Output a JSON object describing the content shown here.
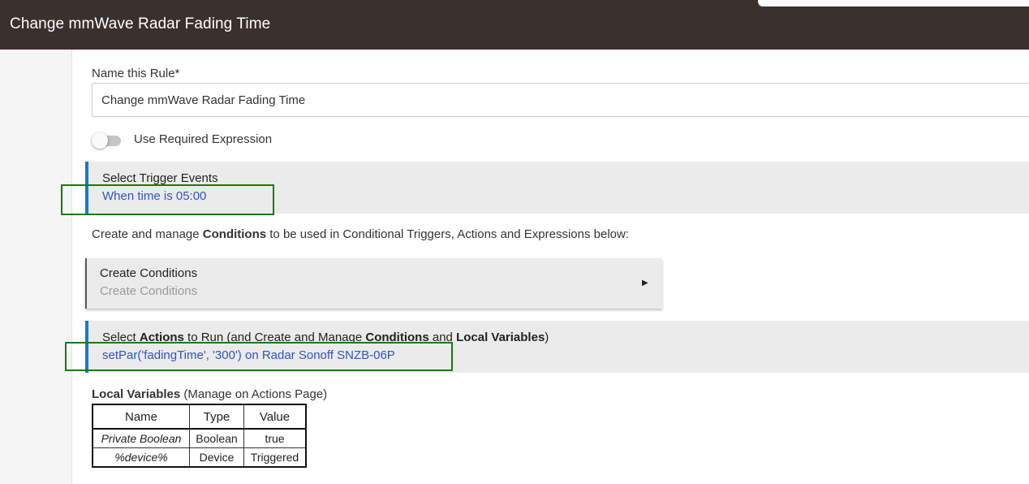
{
  "header": {
    "title": "Change mmWave Radar Fading Time"
  },
  "rule_name": {
    "label": "Name this Rule*",
    "value": "Change mmWave Radar Fading Time"
  },
  "required_expression": {
    "label": "Use Required Expression",
    "enabled": false
  },
  "trigger": {
    "heading": "Select Trigger Events",
    "summary": "When time is 05:00"
  },
  "conditions_intro": {
    "before": "Create and manage ",
    "bold": "Conditions",
    "after": " to be used in Conditional Triggers, Actions and Expressions below:"
  },
  "create_conditions": {
    "heading": "Create Conditions",
    "sub": "Create Conditions",
    "arrow": "▶"
  },
  "actions": {
    "p1": "Select ",
    "b1": "Actions",
    "p2": " to Run (and Create and Manage ",
    "b2": "Conditions",
    "p3": " and ",
    "b3": "Local Variables",
    "p4": ")",
    "summary": "setPar('fadingTime', '300') on Radar Sonoff SNZB-06P"
  },
  "local_variables": {
    "title_bold": "Local Variables",
    "title_rest": " (Manage on Actions Page)",
    "columns": [
      "Name",
      "Type",
      "Value"
    ],
    "rows": [
      {
        "name": "Private Boolean",
        "type": "Boolean",
        "value": "true"
      },
      {
        "name": "%device%",
        "type": "Device",
        "value": "Triggered"
      }
    ]
  },
  "colors": {
    "header_bg": "#3a302d",
    "accent_blue": "#1b78d0",
    "link_blue": "#2f55c2",
    "highlight_green": "#157c14"
  }
}
